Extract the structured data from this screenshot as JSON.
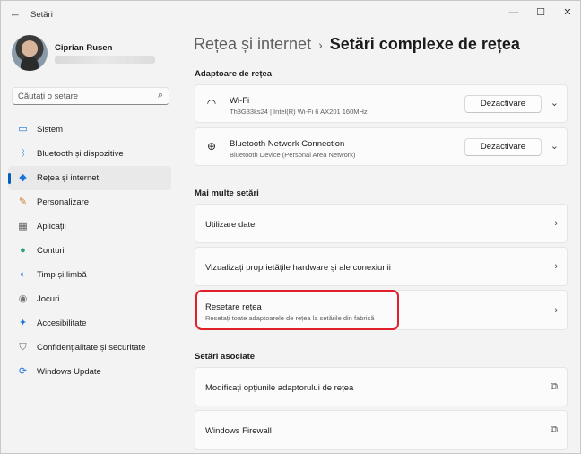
{
  "window": {
    "title": "Setări",
    "back_glyph": "←",
    "minimize_glyph": "—",
    "maximize_glyph": "☐",
    "close_glyph": "✕"
  },
  "profile": {
    "name": "Ciprian Rusen"
  },
  "search": {
    "placeholder": "Căutați o setare",
    "icon": "search-icon"
  },
  "sidebar": {
    "items": [
      {
        "label": "Sistem",
        "icon": "monitor-icon",
        "glyph": "▭",
        "color": "#1e73d8"
      },
      {
        "label": "Bluetooth și dispozitive",
        "icon": "bluetooth-icon",
        "glyph": "ᛒ",
        "color": "#1e73d8"
      },
      {
        "label": "Rețea și internet",
        "icon": "wifi-icon",
        "glyph": "◆",
        "color": "#1e73d8",
        "selected": true
      },
      {
        "label": "Personalizare",
        "icon": "brush-icon",
        "glyph": "✎",
        "color": "#d07a2a"
      },
      {
        "label": "Aplicații",
        "icon": "apps-icon",
        "glyph": "▦",
        "color": "#555555"
      },
      {
        "label": "Conturi",
        "icon": "person-icon",
        "glyph": "●",
        "color": "#2aa07a"
      },
      {
        "label": "Timp și limbă",
        "icon": "globe-clock-icon",
        "glyph": "◐",
        "color": "#1e73d8"
      },
      {
        "label": "Jocuri",
        "icon": "gamepad-icon",
        "glyph": "◉",
        "color": "#777777"
      },
      {
        "label": "Accesibilitate",
        "icon": "accessibility-icon",
        "glyph": "✦",
        "color": "#1e73d8"
      },
      {
        "label": "Confidențialitate și securitate",
        "icon": "shield-icon",
        "glyph": "⛉",
        "color": "#666666"
      },
      {
        "label": "Windows Update",
        "icon": "update-icon",
        "glyph": "⟳",
        "color": "#1e73d8"
      }
    ]
  },
  "breadcrumb": {
    "parent": "Rețea și internet",
    "separator": "›",
    "current": "Setări complexe de rețea"
  },
  "adapters": {
    "heading": "Adaptoare de rețea",
    "items": [
      {
        "title": "Wi-Fi",
        "subtitle": "Th3G33ks24 | Intel(R) Wi-Fi 6 AX201 160MHz",
        "button": "Dezactivare",
        "icon": "wifi-icon",
        "glyph": "◠"
      },
      {
        "title": "Bluetooth Network Connection",
        "subtitle": "Bluetooth Device (Personal Area Network)",
        "button": "Dezactivare",
        "icon": "globe-icon",
        "glyph": "⊕"
      }
    ],
    "expand_glyph": "⌄"
  },
  "more": {
    "heading": "Mai multe setări",
    "items": [
      {
        "title": "Utilizare date"
      },
      {
        "title": "Vizualizați proprietățile hardware și ale conexiunii"
      },
      {
        "title": "Resetare rețea",
        "subtitle": "Resetați toate adaptoarele de rețea la setările din fabrică"
      }
    ],
    "chevron_glyph": "›"
  },
  "related": {
    "heading": "Setări asociate",
    "items": [
      {
        "title": "Modificați opțiunile adaptorului de rețea"
      },
      {
        "title": "Windows Firewall"
      }
    ],
    "external_glyph": "⧉"
  },
  "colors": {
    "accent": "#005fb8",
    "highlight": "#e0202a"
  }
}
